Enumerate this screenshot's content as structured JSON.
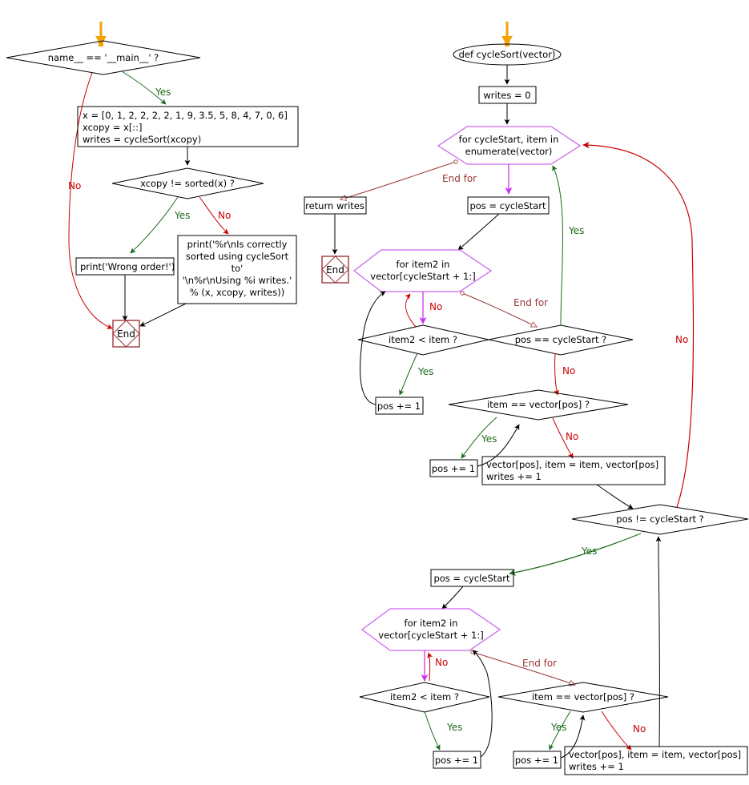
{
  "diagram": {
    "title": "cycleSort flowchart",
    "type": "flowchart",
    "colors": {
      "start_marker": "#f5a202",
      "loop_outline": "#cc66ee",
      "loop_arrow": "#cc33ee",
      "end_node": "#9d3535",
      "yes_edge": "#1d6b1d",
      "no_edge": "#cc0000",
      "endfor_edge": "#9d3535",
      "default_edge": "#000000",
      "node_outline": "#000000"
    },
    "edge_labels": {
      "yes": "Yes",
      "no": "No",
      "end_for": "End for"
    }
  },
  "left_flow": {
    "nodes": [
      {
        "id": "L1",
        "shape": "decision",
        "text": "name__ == '__main__' ?"
      },
      {
        "id": "L2",
        "shape": "process",
        "lines": [
          "x = [0, 1, 2, 2, 2, 2, 1, 9, 3.5, 5, 8, 4, 7, 0, 6]",
          "xcopy = x[::]",
          "writes = cycleSort(xcopy)"
        ]
      },
      {
        "id": "L3",
        "shape": "decision",
        "text": "xcopy != sorted(x) ?"
      },
      {
        "id": "L4",
        "shape": "process",
        "lines": [
          "print('Wrong order!')"
        ]
      },
      {
        "id": "L5",
        "shape": "process",
        "lines": [
          "print('%r\\nIs correctly",
          "sorted using cycleSort",
          "to'",
          "'\\n%r\\nUsing %i writes.'",
          "% (x, xcopy, writes))"
        ]
      },
      {
        "id": "L6",
        "shape": "end",
        "text": "End"
      }
    ]
  },
  "right_flow": {
    "nodes": [
      {
        "id": "R1",
        "shape": "terminator",
        "text": "def cycleSort(vector)"
      },
      {
        "id": "R2",
        "shape": "process",
        "lines": [
          "writes = 0"
        ]
      },
      {
        "id": "R3",
        "shape": "loop",
        "lines": [
          "for cycleStart, item in",
          "enumerate(vector)"
        ]
      },
      {
        "id": "R4",
        "shape": "process",
        "lines": [
          "return writes"
        ]
      },
      {
        "id": "R5",
        "shape": "end",
        "text": "End"
      },
      {
        "id": "R6",
        "shape": "process",
        "lines": [
          "pos = cycleStart"
        ]
      },
      {
        "id": "R7",
        "shape": "loop",
        "lines": [
          "for item2 in",
          "vector[cycleStart + 1:]"
        ]
      },
      {
        "id": "R8",
        "shape": "decision",
        "text": "item2 < item ?"
      },
      {
        "id": "R9",
        "shape": "decision",
        "text": "pos == cycleStart ?"
      },
      {
        "id": "R10",
        "shape": "process",
        "lines": [
          "pos += 1"
        ]
      },
      {
        "id": "R11",
        "shape": "decision",
        "text": "item == vector[pos] ?"
      },
      {
        "id": "R12",
        "shape": "process",
        "lines": [
          "pos += 1"
        ]
      },
      {
        "id": "R13",
        "shape": "process",
        "lines": [
          "vector[pos], item = item, vector[pos]",
          "writes += 1"
        ]
      },
      {
        "id": "R14",
        "shape": "decision",
        "text": "pos != cycleStart ?"
      },
      {
        "id": "R15",
        "shape": "process",
        "lines": [
          "pos = cycleStart"
        ]
      },
      {
        "id": "R16",
        "shape": "loop",
        "lines": [
          "for item2 in",
          "vector[cycleStart + 1:]"
        ]
      },
      {
        "id": "R17",
        "shape": "decision",
        "text": "item2 < item ?"
      },
      {
        "id": "R18",
        "shape": "decision",
        "text": "item == vector[pos] ?"
      },
      {
        "id": "R19",
        "shape": "process",
        "lines": [
          "pos += 1"
        ]
      },
      {
        "id": "R20",
        "shape": "process",
        "lines": [
          "pos += 1"
        ]
      },
      {
        "id": "R21",
        "shape": "process",
        "lines": [
          "vector[pos], item = item, vector[pos]",
          "writes += 1"
        ]
      }
    ]
  },
  "labels": {
    "l_yes_main": "Yes",
    "l_no_main": "No",
    "l_yes_sorted": "Yes",
    "l_no_sorted": "No",
    "r_endfor_1": "End for",
    "r_yes_poscycle": "Yes",
    "r_no_item2": "No",
    "r_endfor_2": "End for",
    "r_yes_item2": "Yes",
    "r_no_poscycle": "No",
    "r_yes_itemvec": "Yes",
    "r_no_itemvec": "No",
    "r_no_right": "No",
    "r_yes_posne": "Yes",
    "r_no_item2b": "No",
    "r_endfor_3": "End for",
    "r_yes_item2b": "Yes",
    "r_yes_itemvecb": "Yes",
    "r_no_itemvecb": "No"
  }
}
